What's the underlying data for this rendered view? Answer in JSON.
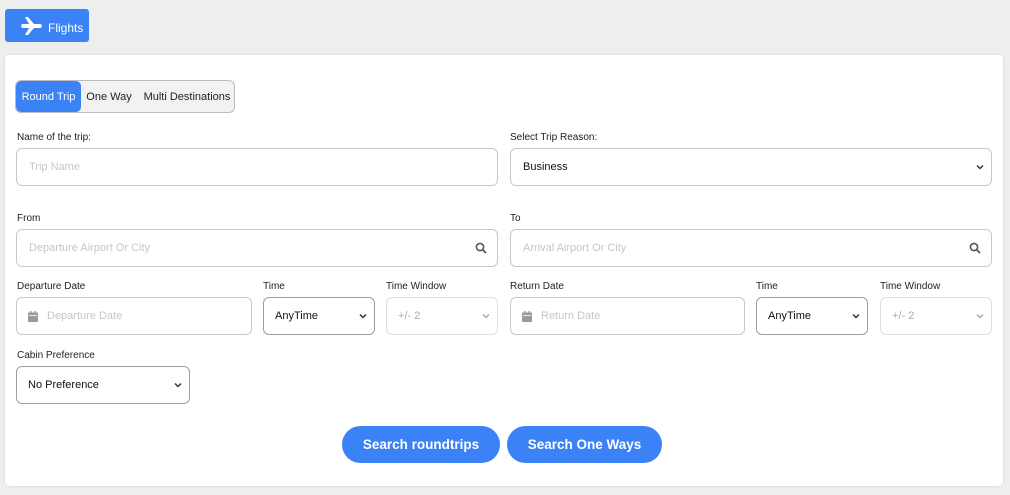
{
  "header": {
    "flights_label": "Flights",
    "icon": "plane-icon"
  },
  "trip_type": {
    "options": [
      "Round Trip",
      "One Way",
      "Multi Destinations"
    ],
    "selected": "Round Trip"
  },
  "form": {
    "trip_name": {
      "label": "Name of the trip:",
      "placeholder": "Trip Name",
      "value": ""
    },
    "trip_reason": {
      "label": "Select Trip Reason:",
      "value": "Business"
    },
    "from": {
      "label": "From",
      "placeholder": "Departure Airport Or City"
    },
    "to": {
      "label": "To",
      "placeholder": "Arrival Airport Or City"
    },
    "departure_date": {
      "label": "Departure Date",
      "placeholder": "Departure Date"
    },
    "departure_time": {
      "label": "Time",
      "value": "AnyTime"
    },
    "departure_window": {
      "label": "Time Window",
      "value": "+/- 2"
    },
    "return_date": {
      "label": "Return Date",
      "placeholder": "Return Date"
    },
    "return_time": {
      "label": "Time",
      "value": "AnyTime"
    },
    "return_window": {
      "label": "Time Window",
      "value": "+/- 2"
    },
    "cabin": {
      "label": "Cabin Preference",
      "value": "No Preference"
    }
  },
  "actions": {
    "search_roundtrips": "Search roundtrips",
    "search_one_ways": "Search One Ways"
  },
  "colors": {
    "accent": "#3b82f6",
    "page_bg": "#eeeeee"
  }
}
